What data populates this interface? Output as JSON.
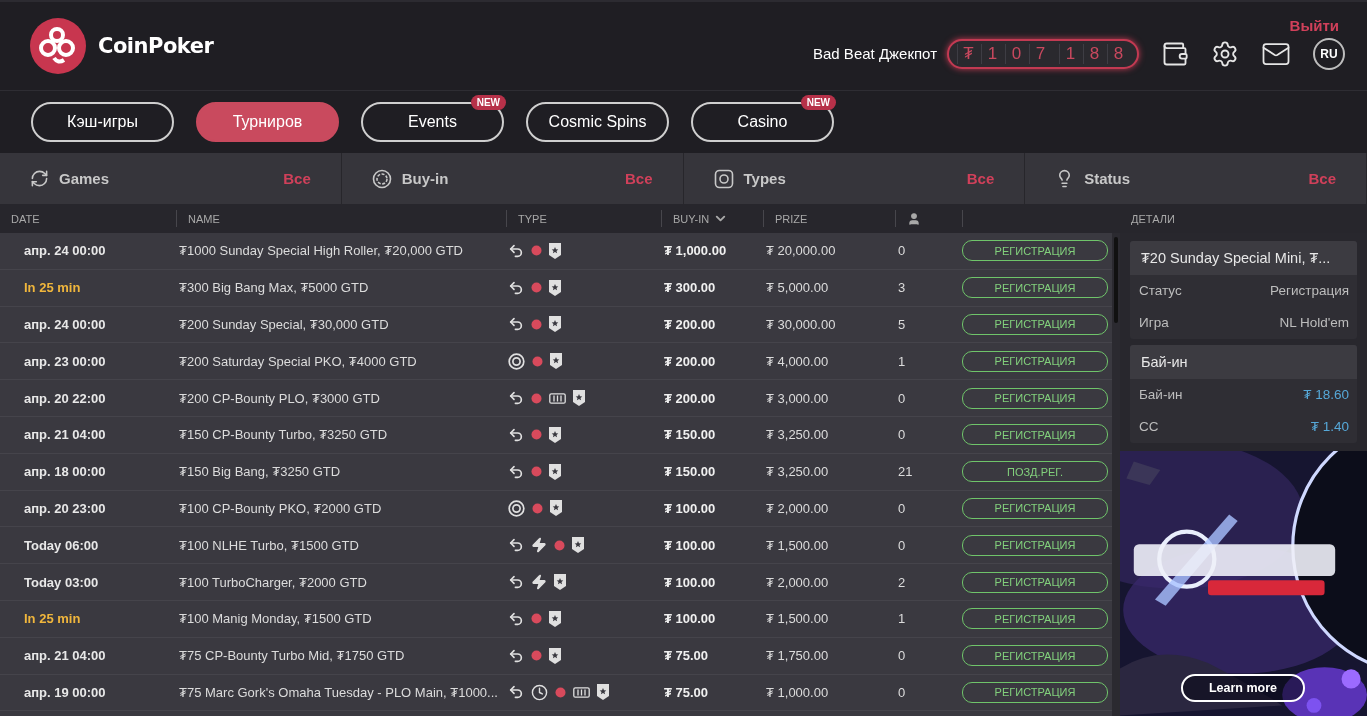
{
  "brand": {
    "name": "CoinPoker"
  },
  "header": {
    "logout": "Выйти",
    "jackpot_label": "Bad Beat Джекпот",
    "jackpot_digits": [
      "₮",
      "1",
      "0",
      "7",
      "1",
      "8",
      "8"
    ],
    "language": "RU"
  },
  "tabs": [
    {
      "label": "Кэш-игры",
      "selected": false
    },
    {
      "label": "Турниров",
      "selected": true
    },
    {
      "label": "Events",
      "selected": false,
      "badge": "NEW"
    },
    {
      "label": "Cosmic Spins",
      "selected": false
    },
    {
      "label": "Casino",
      "selected": false,
      "badge": "NEW"
    }
  ],
  "filters": [
    {
      "kind": "games",
      "label": "Games",
      "value": "Все"
    },
    {
      "kind": "buyin",
      "label": "Buy-in",
      "value": "Все"
    },
    {
      "kind": "types",
      "label": "Types",
      "value": "Все"
    },
    {
      "kind": "status",
      "label": "Status",
      "value": "Все"
    }
  ],
  "table": {
    "columns": [
      {
        "label": "DATE"
      },
      {
        "label": "NAME"
      },
      {
        "label": "TYPE"
      },
      {
        "label": "BUY-IN",
        "sorted": true
      },
      {
        "label": "PRIZE"
      },
      {
        "kind": "players"
      },
      {
        "kind": "status"
      }
    ],
    "rows": [
      {
        "date": "апр. 24 00:00",
        "soon": false,
        "name": "₮1000 Sunday Special High Roller, ₮20,000 GTD",
        "types": [
          {
            "kind": "rebuy"
          },
          {
            "kind": "dot"
          },
          {
            "kind": "shield"
          }
        ],
        "buyin": "₮ 1,000.00",
        "prize": "₮ 20,000.00",
        "players": "0",
        "status": "РЕГИСТРАЦИЯ"
      },
      {
        "date": "In 25 min",
        "soon": true,
        "name": "₮300 Big Bang Max, ₮5000 GTD",
        "types": [
          {
            "kind": "rebuy"
          },
          {
            "kind": "dot"
          },
          {
            "kind": "shield"
          }
        ],
        "buyin": "₮ 300.00",
        "prize": "₮ 5,000.00",
        "players": "3",
        "status": "РЕГИСТРАЦИЯ"
      },
      {
        "date": "апр. 24 00:00",
        "soon": false,
        "name": "₮200 Sunday Special, ₮30,000 GTD",
        "types": [
          {
            "kind": "rebuy"
          },
          {
            "kind": "dot"
          },
          {
            "kind": "shield"
          }
        ],
        "buyin": "₮ 200.00",
        "prize": "₮ 30,000.00",
        "players": "5",
        "status": "РЕГИСТРАЦИЯ"
      },
      {
        "date": "апр. 23 00:00",
        "soon": false,
        "name": "₮200 Saturday Special PKO, ₮4000 GTD",
        "types": [
          {
            "kind": "target"
          },
          {
            "kind": "dot"
          },
          {
            "kind": "shield"
          }
        ],
        "buyin": "₮ 200.00",
        "prize": "₮ 4,000.00",
        "players": "1",
        "status": "РЕГИСТРАЦИЯ"
      },
      {
        "date": "апр. 20 22:00",
        "soon": false,
        "name": "₮200 CP-Bounty PLO, ₮3000 GTD",
        "types": [
          {
            "kind": "rebuy"
          },
          {
            "kind": "dot"
          },
          {
            "kind": "cards"
          },
          {
            "kind": "shield"
          }
        ],
        "buyin": "₮ 200.00",
        "prize": "₮ 3,000.00",
        "players": "0",
        "status": "РЕГИСТРАЦИЯ"
      },
      {
        "date": "апр. 21 04:00",
        "soon": false,
        "name": "₮150 CP-Bounty Turbo, ₮3250 GTD",
        "types": [
          {
            "kind": "rebuy"
          },
          {
            "kind": "dot"
          },
          {
            "kind": "shield"
          }
        ],
        "buyin": "₮ 150.00",
        "prize": "₮ 3,250.00",
        "players": "0",
        "status": "РЕГИСТРАЦИЯ"
      },
      {
        "date": "апр. 18 00:00",
        "soon": false,
        "name": "₮150 Big Bang, ₮3250 GTD",
        "types": [
          {
            "kind": "rebuy"
          },
          {
            "kind": "dot"
          },
          {
            "kind": "shield"
          }
        ],
        "buyin": "₮ 150.00",
        "prize": "₮ 3,250.00",
        "players": "21",
        "status": "ПОЗД.РЕГ."
      },
      {
        "date": "апр. 20 23:00",
        "soon": false,
        "name": "₮100 CP-Bounty PKO, ₮2000 GTD",
        "types": [
          {
            "kind": "target"
          },
          {
            "kind": "dot"
          },
          {
            "kind": "shield"
          }
        ],
        "buyin": "₮ 100.00",
        "prize": "₮ 2,000.00",
        "players": "0",
        "status": "РЕГИСТРАЦИЯ"
      },
      {
        "date": "Today 06:00",
        "soon": false,
        "name": "₮100 NLHE Turbo, ₮1500 GTD",
        "types": [
          {
            "kind": "rebuy"
          },
          {
            "kind": "turbo"
          },
          {
            "kind": "dot"
          },
          {
            "kind": "shield"
          }
        ],
        "buyin": "₮ 100.00",
        "prize": "₮ 1,500.00",
        "players": "0",
        "status": "РЕГИСТРАЦИЯ"
      },
      {
        "date": "Today 03:00",
        "soon": false,
        "name": "₮100 TurboCharger, ₮2000 GTD",
        "types": [
          {
            "kind": "rebuy"
          },
          {
            "kind": "turbo"
          },
          {
            "kind": "shield"
          }
        ],
        "buyin": "₮ 100.00",
        "prize": "₮ 2,000.00",
        "players": "2",
        "status": "РЕГИСТРАЦИЯ"
      },
      {
        "date": "In 25 min",
        "soon": true,
        "name": "₮100 Manig Monday, ₮1500 GTD",
        "types": [
          {
            "kind": "rebuy"
          },
          {
            "kind": "dot"
          },
          {
            "kind": "shield"
          }
        ],
        "buyin": "₮ 100.00",
        "prize": "₮ 1,500.00",
        "players": "1",
        "status": "РЕГИСТРАЦИЯ"
      },
      {
        "date": "апр. 21 04:00",
        "soon": false,
        "name": "₮75 CP-Bounty Turbo Mid, ₮1750 GTD",
        "types": [
          {
            "kind": "rebuy"
          },
          {
            "kind": "dot"
          },
          {
            "kind": "shield"
          }
        ],
        "buyin": "₮ 75.00",
        "prize": "₮ 1,750.00",
        "players": "0",
        "status": "РЕГИСТРАЦИЯ"
      },
      {
        "date": "апр. 19 00:00",
        "soon": false,
        "name": "₮75 Marc Gork's Omaha Tuesday - PLO Main, ₮1000...",
        "types": [
          {
            "kind": "rebuy"
          },
          {
            "kind": "clock"
          },
          {
            "kind": "dot"
          },
          {
            "kind": "cards"
          },
          {
            "kind": "shield"
          }
        ],
        "buyin": "₮ 75.00",
        "prize": "₮ 1,000.00",
        "players": "0",
        "status": "РЕГИСТРАЦИЯ"
      }
    ]
  },
  "details": {
    "heading": "ДЕТАЛИ",
    "title": "₮20 Sunday Special Mini, ₮...",
    "rows": [
      {
        "label": "Статус",
        "value": "Регистрация"
      },
      {
        "label": "Игра",
        "value": "NL Hold'em"
      }
    ],
    "buyin_title": "Бай-ин",
    "buyin_rows": [
      {
        "label": "Бай-ин",
        "value": "₮ 18.60"
      },
      {
        "label": "CC",
        "value": "₮ 1.40"
      }
    ]
  },
  "banner": {
    "kind": "picture",
    "button": "Learn more"
  }
}
